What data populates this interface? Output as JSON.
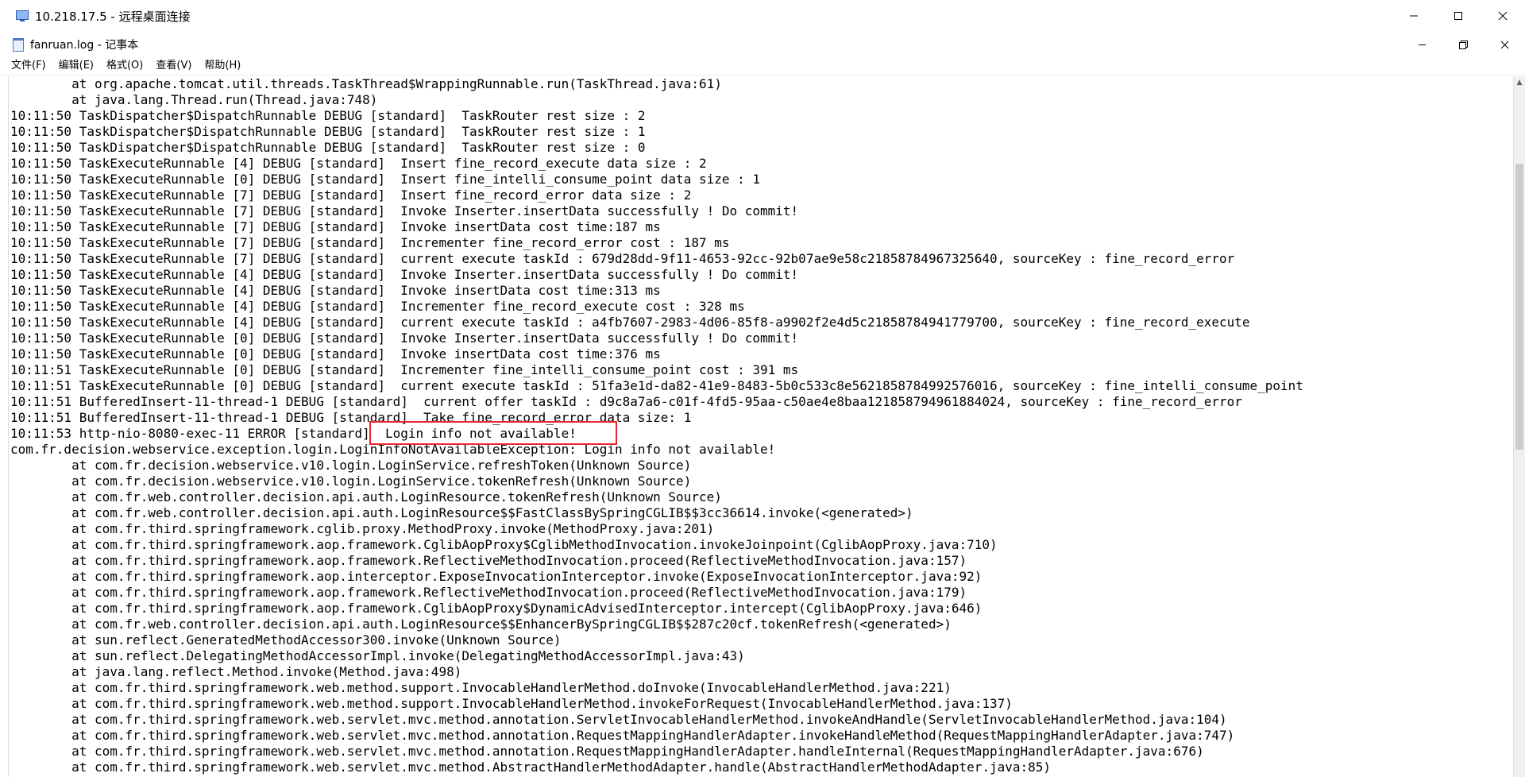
{
  "rdp_window": {
    "title": "10.218.17.5 - 远程桌面连接",
    "minimize_icon": "minimize-icon",
    "maximize_icon": "maximize-icon",
    "close_icon": "close-icon"
  },
  "notepad": {
    "title": "fanruan.log - 记事本",
    "minimize_icon": "minimize-icon",
    "restore_icon": "restore-icon",
    "close_icon": "close-icon"
  },
  "menu": {
    "file": "文件(F)",
    "edit": "编辑(E)",
    "format": "格式(O)",
    "view": "查看(V)",
    "help": "帮助(H)"
  },
  "log_lines": [
    "        at org.apache.tomcat.util.threads.TaskThread$WrappingRunnable.run(TaskThread.java:61)",
    "        at java.lang.Thread.run(Thread.java:748)",
    "10:11:50 TaskDispatcher$DispatchRunnable DEBUG [standard]  TaskRouter rest size : 2",
    "10:11:50 TaskDispatcher$DispatchRunnable DEBUG [standard]  TaskRouter rest size : 1",
    "10:11:50 TaskDispatcher$DispatchRunnable DEBUG [standard]  TaskRouter rest size : 0",
    "10:11:50 TaskExecuteRunnable [4] DEBUG [standard]  Insert fine_record_execute data size : 2",
    "10:11:50 TaskExecuteRunnable [0] DEBUG [standard]  Insert fine_intelli_consume_point data size : 1",
    "10:11:50 TaskExecuteRunnable [7] DEBUG [standard]  Insert fine_record_error data size : 2",
    "10:11:50 TaskExecuteRunnable [7] DEBUG [standard]  Invoke Inserter.insertData successfully ! Do commit!",
    "10:11:50 TaskExecuteRunnable [7] DEBUG [standard]  Invoke insertData cost time:187 ms",
    "10:11:50 TaskExecuteRunnable [7] DEBUG [standard]  Incrementer fine_record_error cost : 187 ms",
    "10:11:50 TaskExecuteRunnable [7] DEBUG [standard]  current execute taskId : 679d28dd-9f11-4653-92cc-92b07ae9e58c21858784967325640, sourceKey : fine_record_error",
    "10:11:50 TaskExecuteRunnable [4] DEBUG [standard]  Invoke Inserter.insertData successfully ! Do commit!",
    "10:11:50 TaskExecuteRunnable [4] DEBUG [standard]  Invoke insertData cost time:313 ms",
    "10:11:50 TaskExecuteRunnable [4] DEBUG [standard]  Incrementer fine_record_execute cost : 328 ms",
    "10:11:50 TaskExecuteRunnable [4] DEBUG [standard]  current execute taskId : a4fb7607-2983-4d06-85f8-a9902f2e4d5c21858784941779700, sourceKey : fine_record_execute",
    "10:11:50 TaskExecuteRunnable [0] DEBUG [standard]  Invoke Inserter.insertData successfully ! Do commit!",
    "10:11:50 TaskExecuteRunnable [0] DEBUG [standard]  Invoke insertData cost time:376 ms",
    "10:11:51 TaskExecuteRunnable [0] DEBUG [standard]  Incrementer fine_intelli_consume_point cost : 391 ms",
    "10:11:51 TaskExecuteRunnable [0] DEBUG [standard]  current execute taskId : 51fa3e1d-da82-41e9-8483-5b0c533c8e5621858784992576016, sourceKey : fine_intelli_consume_point",
    "10:11:51 BufferedInsert-11-thread-1 DEBUG [standard]  current offer taskId : d9c8a7a6-c01f-4fd5-95aa-c50ae4e8baa121858794961884024, sourceKey : fine_record_error",
    "10:11:51 BufferedInsert-11-thread-1 DEBUG [standard]  Take fine_record_error data size: 1",
    "10:11:53 http-nio-8080-exec-11 ERROR [standard]  Login info not available!",
    "com.fr.decision.webservice.exception.login.LoginInfoNotAvailableException: Login info not available!",
    "        at com.fr.decision.webservice.v10.login.LoginService.refreshToken(Unknown Source)",
    "        at com.fr.decision.webservice.v10.login.LoginService.tokenRefresh(Unknown Source)",
    "        at com.fr.web.controller.decision.api.auth.LoginResource.tokenRefresh(Unknown Source)",
    "        at com.fr.web.controller.decision.api.auth.LoginResource$$FastClassBySpringCGLIB$$3cc36614.invoke(<generated>)",
    "        at com.fr.third.springframework.cglib.proxy.MethodProxy.invoke(MethodProxy.java:201)",
    "        at com.fr.third.springframework.aop.framework.CglibAopProxy$CglibMethodInvocation.invokeJoinpoint(CglibAopProxy.java:710)",
    "        at com.fr.third.springframework.aop.framework.ReflectiveMethodInvocation.proceed(ReflectiveMethodInvocation.java:157)",
    "        at com.fr.third.springframework.aop.interceptor.ExposeInvocationInterceptor.invoke(ExposeInvocationInterceptor.java:92)",
    "        at com.fr.third.springframework.aop.framework.ReflectiveMethodInvocation.proceed(ReflectiveMethodInvocation.java:179)",
    "        at com.fr.third.springframework.aop.framework.CglibAopProxy$DynamicAdvisedInterceptor.intercept(CglibAopProxy.java:646)",
    "        at com.fr.web.controller.decision.api.auth.LoginResource$$EnhancerBySpringCGLIB$$287c20cf.tokenRefresh(<generated>)",
    "        at sun.reflect.GeneratedMethodAccessor300.invoke(Unknown Source)",
    "        at sun.reflect.DelegatingMethodAccessorImpl.invoke(DelegatingMethodAccessorImpl.java:43)",
    "        at java.lang.reflect.Method.invoke(Method.java:498)",
    "        at com.fr.third.springframework.web.method.support.InvocableHandlerMethod.doInvoke(InvocableHandlerMethod.java:221)",
    "        at com.fr.third.springframework.web.method.support.InvocableHandlerMethod.invokeForRequest(InvocableHandlerMethod.java:137)",
    "        at com.fr.third.springframework.web.servlet.mvc.method.annotation.ServletInvocableHandlerMethod.invokeAndHandle(ServletInvocableHandlerMethod.java:104)",
    "        at com.fr.third.springframework.web.servlet.mvc.method.annotation.RequestMappingHandlerAdapter.invokeHandleMethod(RequestMappingHandlerAdapter.java:747)",
    "        at com.fr.third.springframework.web.servlet.mvc.method.annotation.RequestMappingHandlerAdapter.handleInternal(RequestMappingHandlerAdapter.java:676)",
    "        at com.fr.third.springframework.web.servlet.mvc.method.AbstractHandlerMethodAdapter.handle(AbstractHandlerMethodAdapter.java:85)"
  ]
}
